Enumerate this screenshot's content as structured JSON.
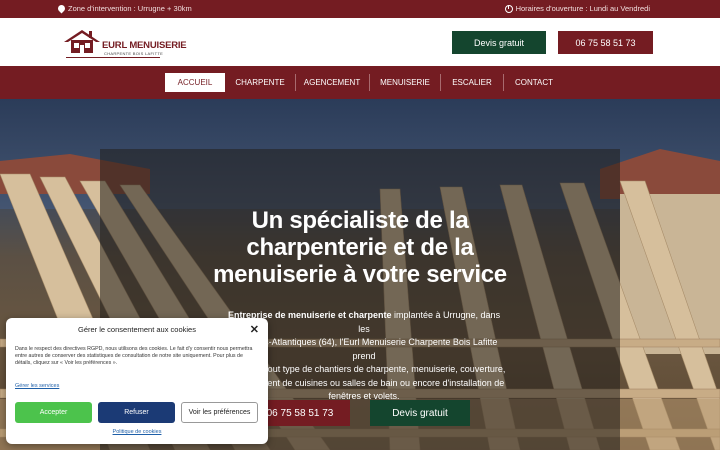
{
  "topbar": {
    "zone_text": "Zone d'intervention : Urrugne + 30km",
    "hours_text": "Horaires d'ouverture : Lundi au Vendredi"
  },
  "header": {
    "logo_name": "EURL MENUISERIE",
    "logo_sub": "CHARPENTE BOIS LAFITTE",
    "devis_label": "Devis gratuit",
    "phone_label": "06 75 58 51 73"
  },
  "nav": {
    "items": [
      {
        "label": "ACCUEIL",
        "active": true
      },
      {
        "label": "CHARPENTE",
        "active": false
      },
      {
        "label": "AGENCEMENT",
        "active": false
      },
      {
        "label": "MENUISERIE",
        "active": false
      },
      {
        "label": "ESCALIER",
        "active": false
      },
      {
        "label": "CONTACT",
        "active": false
      }
    ]
  },
  "hero": {
    "title_line1": "Un spécialiste de la",
    "title_line2": "charpenterie et de la",
    "title_line3": "menuiserie à votre service",
    "text_bold": "Entreprise de menuiserie et charpente",
    "text_line1_rest": " implantée à Urrugne, dans les",
    "text_line2": "Pyrénées-Atlantiques (64), l'Eurl Menuiserie Charpente Bois Lafitte prend",
    "text_line3": "en charge tout type de chantiers de charpente, menuiserie, couverture,",
    "text_line4": "d'agencement de cuisines ou salles de bain ou encore d'installation de",
    "text_line5": "fenêtres et volets.",
    "phone_label": "06 75 58 51 73",
    "devis_label": "Devis gratuit"
  },
  "cookie": {
    "title": "Gérer le consentement aux cookies",
    "close_symbol": "✕",
    "text": "Dans le respect des directives RGPD, nous utilisons des cookies. Le fait d'y consentir nous permettra entre autres de conserver des statistiques de consultation de notre site uniquement. Pour plus de détails, cliquez sur « Voir les préférences ».",
    "manage_label": "Gérer les services",
    "accept_label": "Accepter",
    "refuse_label": "Refuser",
    "prefs_label": "Voir les préférences",
    "policy_label": "Politique de cookies"
  },
  "colors": {
    "brand_red": "#741c22",
    "brand_green": "#14452e",
    "accept_green": "#4cc34c",
    "refuse_blue": "#1b3a75"
  },
  "icons": {
    "zone": "map-pin-icon",
    "hours": "clock-icon",
    "close": "close-icon"
  }
}
